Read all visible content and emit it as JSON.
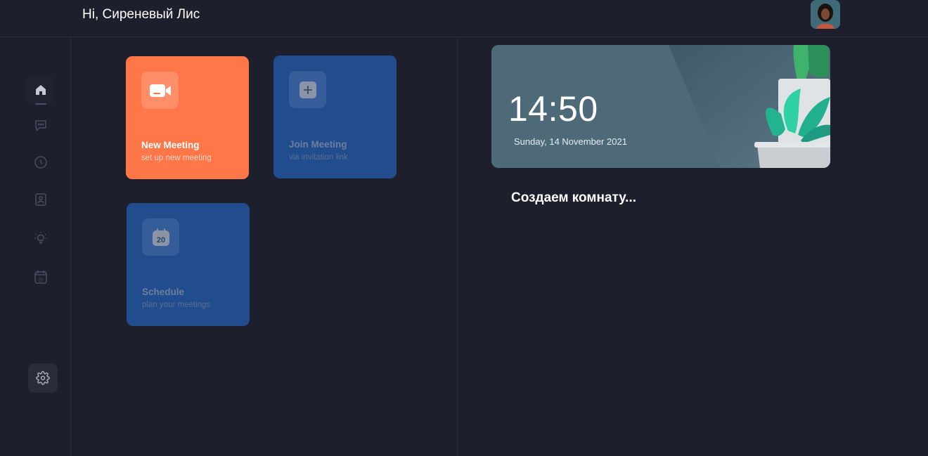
{
  "header": {
    "greeting": "Hi, Сиреневый Лис",
    "avatar_icon": "user-avatar"
  },
  "sidebar": {
    "items": [
      {
        "name": "home",
        "icon": "home-icon",
        "active": true
      },
      {
        "name": "chat",
        "icon": "chat-icon",
        "active": false
      },
      {
        "name": "history",
        "icon": "clock-icon",
        "active": false
      },
      {
        "name": "contacts",
        "icon": "contact-card-icon",
        "active": false
      },
      {
        "name": "ideas",
        "icon": "lightbulb-icon",
        "active": false
      },
      {
        "name": "calendar",
        "icon": "calendar-icon",
        "active": false
      }
    ],
    "settings_icon": "gear-icon"
  },
  "actions": {
    "new_meeting": {
      "title": "New Meeting",
      "subtitle": "set up new meeting",
      "icon": "video-camera-icon"
    },
    "join_meeting": {
      "title": "Join Meeting",
      "subtitle": "via invitation link",
      "icon": "plus-icon"
    },
    "schedule": {
      "title": "Schedule",
      "subtitle": "plan your meetings",
      "icon": "calendar-icon",
      "icon_text": "20"
    }
  },
  "clock": {
    "time": "14:50",
    "date": "Sunday, 14 November 2021"
  },
  "status": {
    "text": "Создаем комнату..."
  },
  "colors": {
    "background": "#1d1f2c",
    "accent_orange": "#ff7648",
    "card_blue": "#214d8f",
    "clock_card": "#4f6a79"
  }
}
